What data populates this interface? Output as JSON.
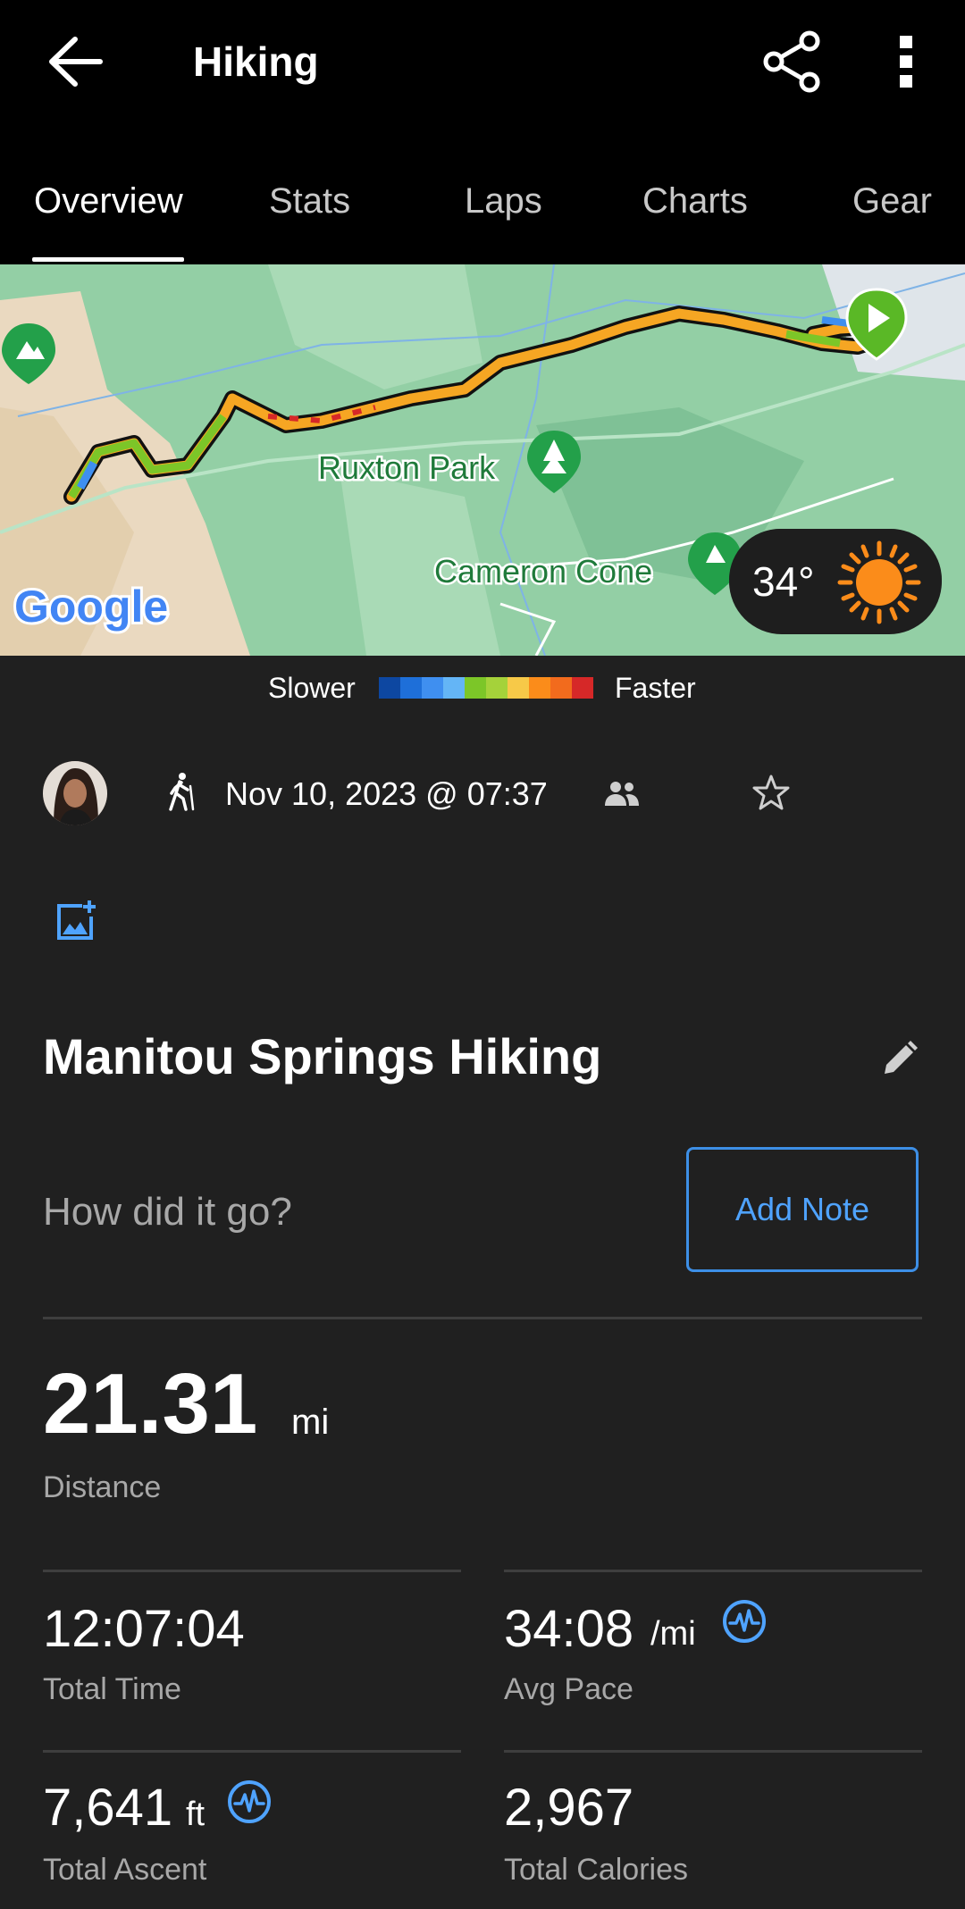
{
  "app_bar": {
    "title": "Hiking",
    "icons": [
      "back-arrow-icon",
      "share-icon",
      "more-vert-icon"
    ]
  },
  "tabs": [
    {
      "label": "Overview",
      "active": true
    },
    {
      "label": "Stats",
      "active": false
    },
    {
      "label": "Laps",
      "active": false
    },
    {
      "label": "Charts",
      "active": false
    },
    {
      "label": "Gear",
      "active": false
    }
  ],
  "map": {
    "labels": {
      "park": "Ruxton Park",
      "cone": "Cameron Cone",
      "logo": "Google"
    },
    "weather": {
      "temperature": "34°",
      "condition_icon": "sun-icon"
    }
  },
  "legend": {
    "slower": "Slower",
    "faster": "Faster",
    "colors": [
      "#0d47a1",
      "#1e6fd9",
      "#3f8ff0",
      "#64b5f6",
      "#7cc628",
      "#a5d23a",
      "#f7c948",
      "#fb8c1a",
      "#f26b1d",
      "#d62828"
    ]
  },
  "activity": {
    "datetime": "Nov 10, 2023 @ 07:37",
    "name": "Manitou Springs Hiking",
    "note_prompt": "How did it go?",
    "add_note_label": "Add Note"
  },
  "stats": {
    "distance": {
      "value": "21.31",
      "unit": "mi",
      "label": "Distance"
    },
    "total_time": {
      "value": "12:07:04",
      "label": "Total Time"
    },
    "avg_pace": {
      "value": "34:08",
      "unit": "/mi",
      "label": "Avg Pace"
    },
    "total_ascent": {
      "value": "7,641",
      "unit": "ft",
      "label": "Total Ascent"
    },
    "total_calories": {
      "value": "2,967",
      "label": "Total Calories"
    }
  },
  "colors": {
    "accent_blue": "#4fa3ff",
    "background": "#202020",
    "app_bar": "#000000"
  }
}
